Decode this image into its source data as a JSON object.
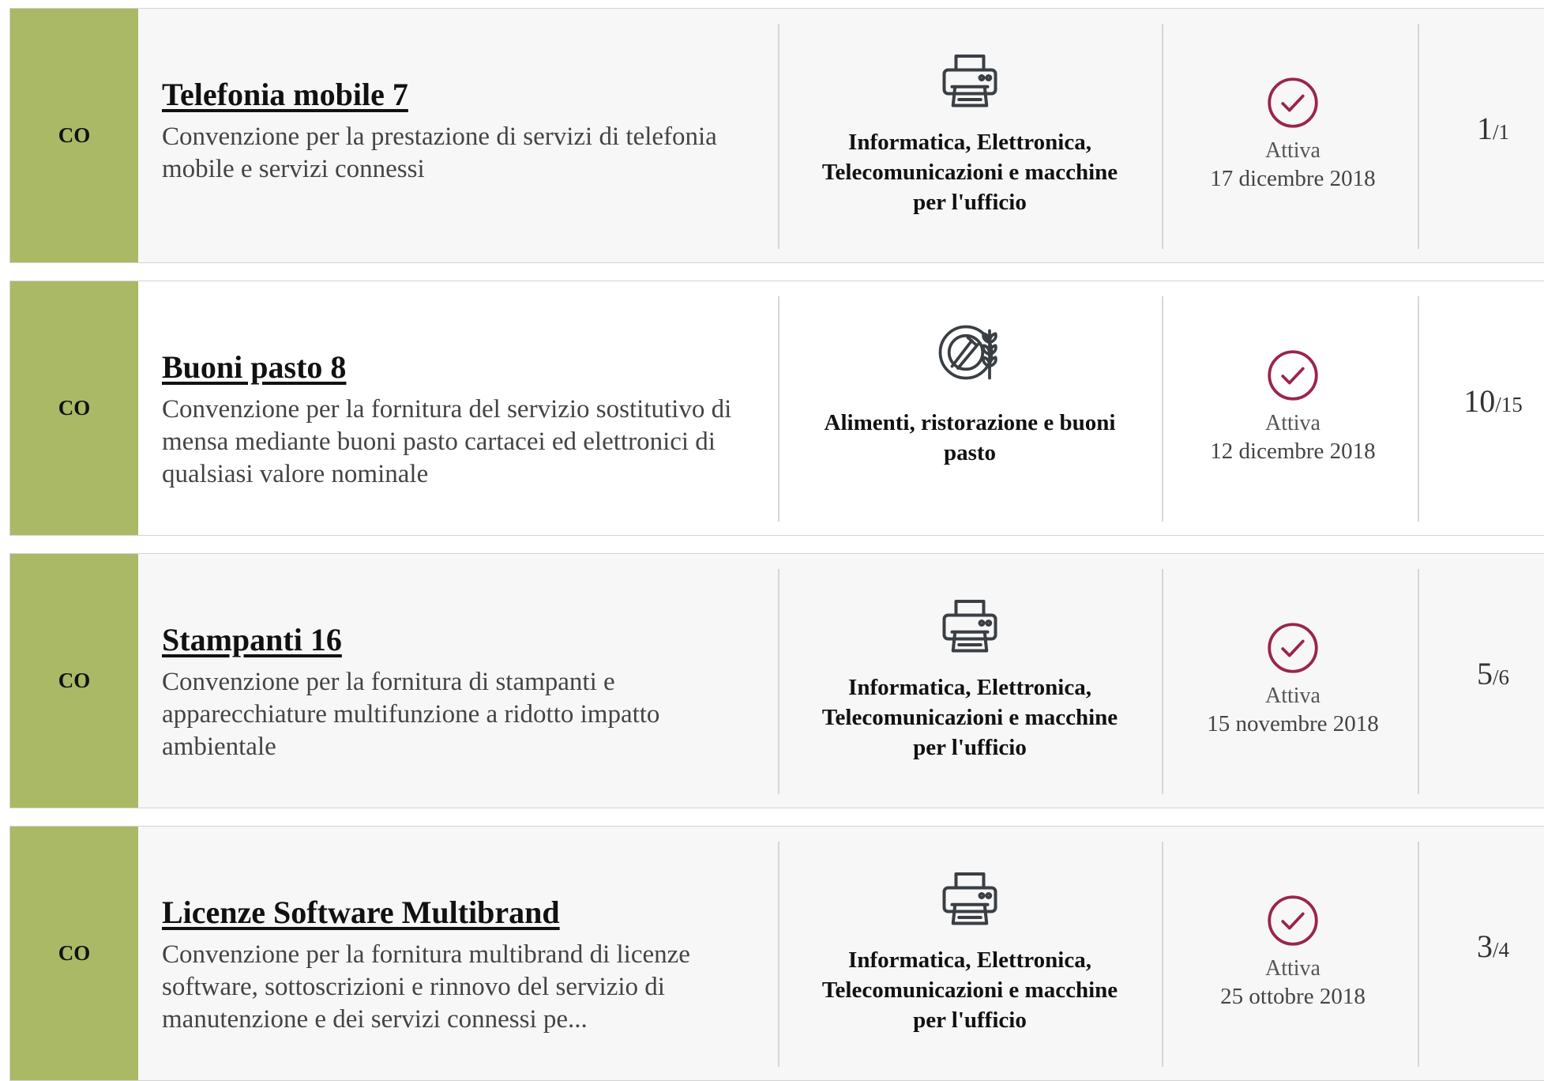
{
  "colors": {
    "type_strip": "#a9b965",
    "status_check": "#9b2450"
  },
  "items": [
    {
      "type_code": "CO",
      "title": "Telefonia mobile 7",
      "description": "Convenzione per la prestazione di servizi di telefonia mobile e servizi connessi",
      "category_icon": "printer-icon",
      "category": "Informatica, Elettronica, Telecomunicazioni e macchine per l'ufficio",
      "status_icon": "check-circle-icon",
      "status": "Attiva",
      "date": "17 dicembre 2018",
      "count_current": "1",
      "count_total": "/1"
    },
    {
      "type_code": "CO",
      "title": "Buoni pasto 8",
      "description": "Convenzione per la fornitura del servizio sostitutivo di mensa mediante buoni pasto cartacei ed elettronici di qualsiasi valore nominale",
      "category_icon": "food-plate-icon",
      "category": "Alimenti, ristorazione e buoni pasto",
      "status_icon": "check-circle-icon",
      "status": "Attiva",
      "date": "12 dicembre 2018",
      "count_current": "10",
      "count_total": "/15"
    },
    {
      "type_code": "CO",
      "title": "Stampanti 16",
      "description": "Convenzione per la fornitura di stampanti e apparecchiature multifunzione a ridotto impatto ambientale",
      "category_icon": "printer-icon",
      "category": "Informatica, Elettronica, Telecomunicazioni e macchine per l'ufficio",
      "status_icon": "check-circle-icon",
      "status": "Attiva",
      "date": "15 novembre 2018",
      "count_current": "5",
      "count_total": "/6"
    },
    {
      "type_code": "CO",
      "title": "Licenze Software Multibrand",
      "description": "Convenzione per la fornitura multibrand di licenze software, sottoscrizioni e rinnovo del servizio di manutenzione e dei servizi connessi pe...",
      "category_icon": "printer-icon",
      "category": "Informatica, Elettronica, Telecomunicazioni e macchine per l'ufficio",
      "status_icon": "check-circle-icon",
      "status": "Attiva",
      "date": "25 ottobre 2018",
      "count_current": "3",
      "count_total": "/4"
    }
  ]
}
